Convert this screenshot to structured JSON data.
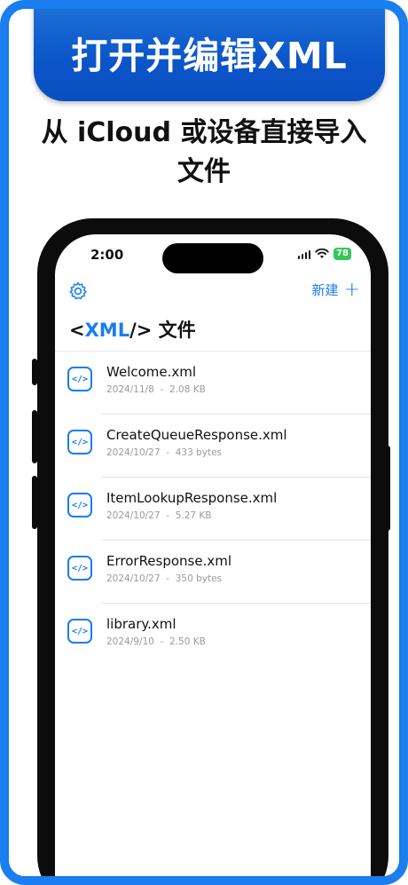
{
  "banner": {
    "title": "打开并编辑XML"
  },
  "subtitle": {
    "line1": "从 iCloud 或设备直接导入",
    "line2": "文件"
  },
  "status_bar": {
    "time": "2:00",
    "battery": "78"
  },
  "nav": {
    "settings_icon": "gear-icon",
    "new_label": "新建",
    "new_icon": "plus"
  },
  "page": {
    "title_open": "<",
    "title_xml": "XML",
    "title_close": "/>",
    "title_suffix": " 文件"
  },
  "files": [
    {
      "name": "Welcome.xml",
      "date": "2024/11/8",
      "size": "2.08 KB"
    },
    {
      "name": "CreateQueueResponse.xml",
      "date": "2024/10/27",
      "size": "433 bytes"
    },
    {
      "name": "ItemLookupResponse.xml",
      "date": "2024/10/27",
      "size": "5.27 KB"
    },
    {
      "name": "ErrorResponse.xml",
      "date": "2024/10/27",
      "size": "350 bytes"
    },
    {
      "name": "library.xml",
      "date": "2024/9/10",
      "size": "2.50 KB"
    }
  ],
  "file_icon": {
    "glyph": "</>",
    "semantic": "xml-file-icon"
  },
  "meta_separator": "-",
  "colors": {
    "accent": "#1a7df0",
    "banner": "#0b55c9",
    "battery": "#34c759"
  }
}
